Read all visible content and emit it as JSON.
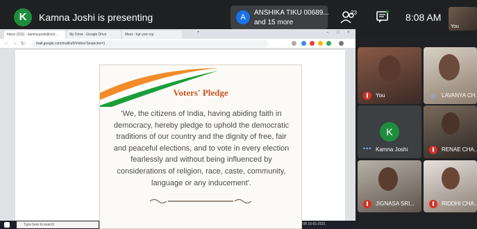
{
  "presenter": {
    "avatar_letter": "K",
    "text": "Kamna Joshi is presenting"
  },
  "participants_chip": {
    "avatar_letter": "A",
    "name": "ANSHIKA TIKU 00689...",
    "more": "and 15 more"
  },
  "people": {
    "count": "23"
  },
  "clock": "8:08 AM",
  "self_view_label": "You",
  "browser": {
    "tabs": [
      "Inbox (231) - kamna.joshi@sch...",
      "My Drive - Google Drive",
      "Meet - hgr-yxrr-rxp"
    ],
    "url": "mail.google.com/mail/u/0/#inbox?projector=1"
  },
  "slide": {
    "title": "Voters' Pledge",
    "body": "'We, the citizens of India, having abiding faith in democracy, hereby pledge to uphold the democratic traditions of our country and the dignity of free, fair and peaceful elections, and to vote in every election fearlessly and without being influenced by considerations of religion, race, caste, community, language or any inducement'."
  },
  "taskbar": {
    "search_placeholder": "Type here to search",
    "tray": "ENG  8:08  15-01-2021"
  },
  "tiles": [
    {
      "name": "You"
    },
    {
      "name": "LAVANYA CH..."
    },
    {
      "name": "Kamna Joshi",
      "avatar_letter": "K"
    },
    {
      "name": "RENAE CHA..."
    },
    {
      "name": "JIGNASA SRI..."
    },
    {
      "name": "RIDDHI CHA..."
    }
  ],
  "colors": {
    "accent_green": "#1e8e3e",
    "mic_off_red": "#d93025",
    "slide_title": "#c2571f"
  }
}
